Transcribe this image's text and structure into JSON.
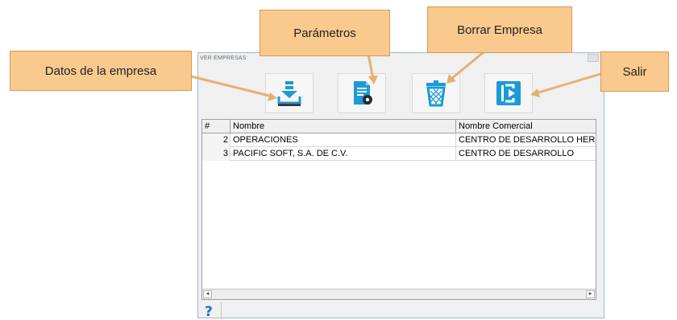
{
  "window": {
    "title": "VER EMPRESAS"
  },
  "toolbar": {
    "buttons": [
      {
        "icon": "download-stack-icon",
        "tooltip": "Datos de la empresa"
      },
      {
        "icon": "document-gear-icon",
        "tooltip": "Parámetros"
      },
      {
        "icon": "trash-basket-icon",
        "tooltip": "Borrar Empresa"
      },
      {
        "icon": "exit-door-icon",
        "tooltip": "Salir"
      }
    ]
  },
  "grid": {
    "columns": [
      "#",
      "Nombre",
      "Nombre Comercial"
    ],
    "rows": [
      {
        "num": "2",
        "nombre": "OPERACIONES",
        "comercial": "CENTRO DE DESARROLLO HER"
      },
      {
        "num": "3",
        "nombre": "PACIFIC SOFT, S.A. DE C.V.",
        "comercial": "CENTRO DE DESARROLLO"
      }
    ]
  },
  "help": {
    "symbol": "?"
  },
  "callouts": {
    "datos": "Datos de la empresa",
    "parametros": "Parámetros",
    "borrar": "Borrar Empresa",
    "salir": "Salir"
  },
  "colors": {
    "icon_blue": "#1a9ad7",
    "callout_fill": "#f9c98e",
    "callout_border": "#d79a55"
  }
}
